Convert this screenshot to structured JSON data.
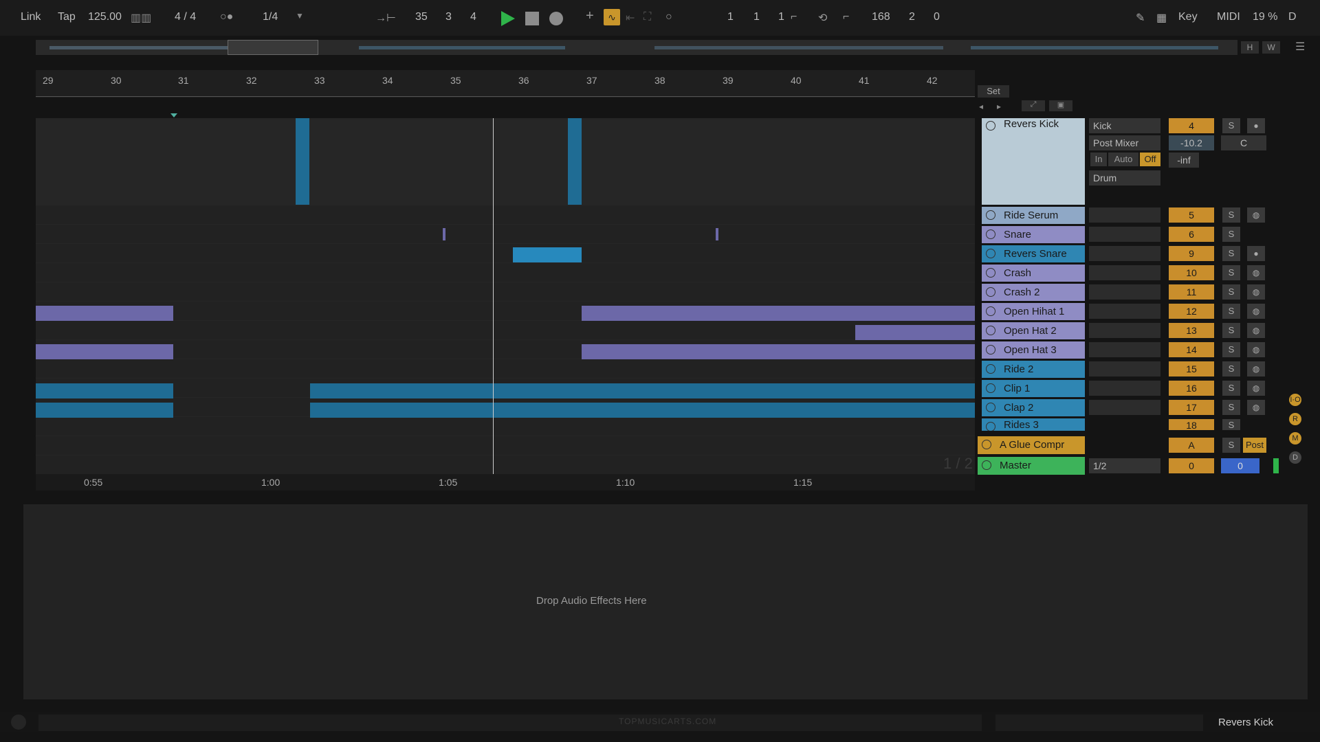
{
  "transport": {
    "link": "Link",
    "tap": "Tap",
    "tempo": "125.00",
    "time_signature": "4 / 4",
    "quantization": "1/4",
    "position_bar": "35",
    "position_beat": "3",
    "position_sixteenth": "4",
    "loop_start_bar": "1",
    "loop_start_beat": "1",
    "loop_start_sixteenth": "1",
    "loop_length_bar": "168",
    "loop_length_beat": "2",
    "loop_length_sixteenth": "0",
    "key_label": "Key",
    "midi_label": "MIDI",
    "cpu_load": "19 %",
    "d_label": "D"
  },
  "overview": {
    "h_label": "H",
    "w_label": "W"
  },
  "ruler": {
    "bars": [
      "29",
      "30",
      "31",
      "32",
      "33",
      "34",
      "35",
      "36",
      "37",
      "38",
      "39",
      "40",
      "41",
      "42"
    ]
  },
  "timeline": {
    "times": [
      "0:55",
      "1:00",
      "1:05",
      "1:10",
      "1:15"
    ],
    "page": "1 / 2"
  },
  "set_panel": {
    "set_label": "Set"
  },
  "tracks": [
    {
      "name": "Revers Kick",
      "number": "4",
      "color": "#b9cbd6"
    },
    {
      "name": "Ride Serum",
      "number": "5",
      "color": "#8fa8c6"
    },
    {
      "name": "Snare",
      "number": "6",
      "color": "#8f8cc4"
    },
    {
      "name": "Revers Snare",
      "number": "9",
      "color": "#2f86b3"
    },
    {
      "name": "Crash",
      "number": "10",
      "color": "#8f8cc4"
    },
    {
      "name": "Crash 2",
      "number": "11",
      "color": "#8f8cc4"
    },
    {
      "name": "Open Hihat 1",
      "number": "12",
      "color": "#8f8cc4"
    },
    {
      "name": "Open Hat 2",
      "number": "13",
      "color": "#8f8cc4"
    },
    {
      "name": "Open Hat 3",
      "number": "14",
      "color": "#8f8cc4"
    },
    {
      "name": "Ride 2",
      "number": "15",
      "color": "#2f86b3"
    },
    {
      "name": "Clip 1",
      "number": "16",
      "color": "#2f86b3"
    },
    {
      "name": "Clap 2",
      "number": "17",
      "color": "#2f86b3"
    },
    {
      "name": "Rides 3",
      "number": "18",
      "color": "#2f86b3"
    }
  ],
  "kick_track_io": {
    "input_type": "Kick",
    "input_channel": "Post Mixer",
    "monitor_in": "In",
    "monitor_auto": "Auto",
    "monitor_off": "Off",
    "volume": "-10.2",
    "pan": "C",
    "send": "-inf",
    "output": "Drum"
  },
  "return_track": {
    "name": "A Glue Compr",
    "number": "A",
    "solo": "S",
    "post": "Post",
    "color": "#c9962b"
  },
  "master_track": {
    "name": "Master",
    "output": "1/2",
    "volume": "0",
    "pan": "0",
    "color": "#3db35a"
  },
  "solo_label": "S",
  "device_view": {
    "drop_text": "Drop Audio Effects Here"
  },
  "status": {
    "selected_track": "Revers Kick",
    "watermark": "TOPMUSICARTS.COM"
  }
}
